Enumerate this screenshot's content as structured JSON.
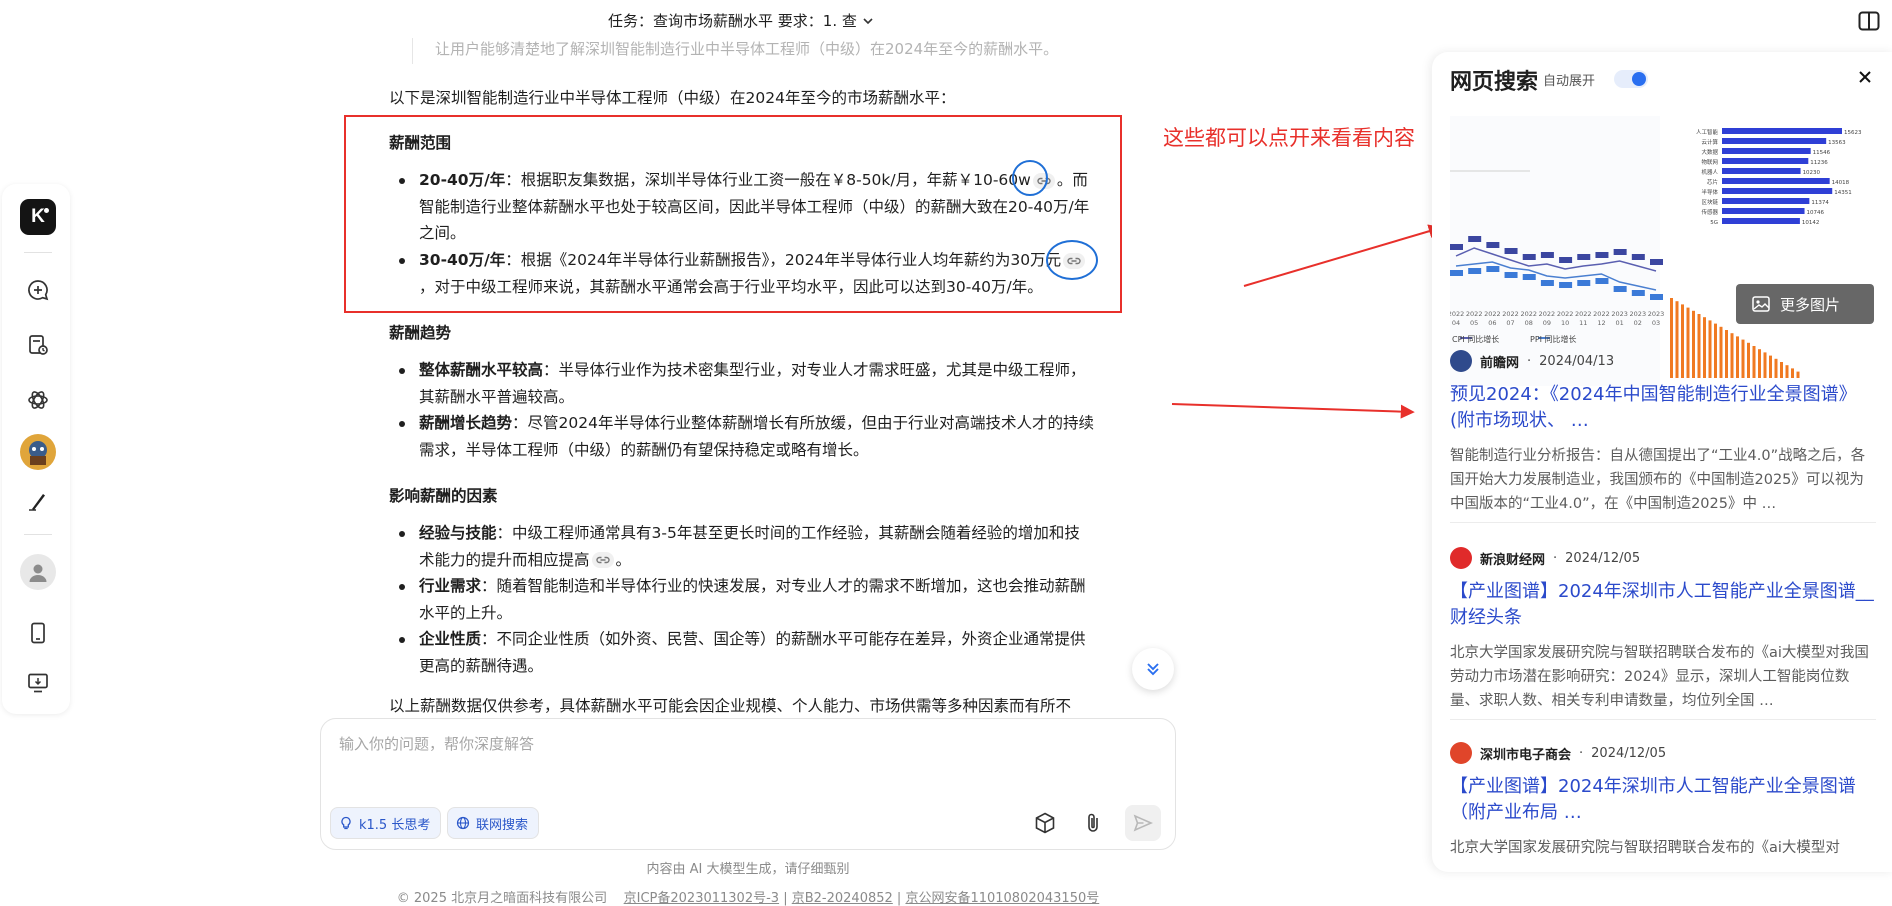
{
  "header": {
    "task_text": "任务：查询市场薪酬水平 要求：1. 查"
  },
  "chat": {
    "faded_line": "让用户能够清楚地了解深圳智能制造行业中半导体工程师（中级）在2024年至今的薪酬水平。",
    "intro": "以下是深圳智能制造行业中半导体工程师（中级）在2024年至今的市场薪酬水平：",
    "sections": [
      {
        "title": "薪酬范围",
        "items": [
          {
            "bold": "20-40万/年",
            "before_cite": "：根据职友集数据，深圳半导体行业工资一般在￥8-50k/月，年薪￥10-60w",
            "after_cite": "。而智能制造行业整体薪酬水平也处于较高区间，因此半导体工程师（中级）的薪酬大致在20-40万/年之间。"
          },
          {
            "bold": "30-40万/年",
            "before_cite": "：根据《2024年半导体行业薪酬报告》，2024年半导体行业人均年薪约为30万元",
            "after_cite": "，对于中级工程师来说，其薪酬水平通常会高于行业平均水平，因此可以达到30-40万/年。"
          }
        ]
      },
      {
        "title": "薪酬趋势",
        "items": [
          {
            "bold": "整体薪酬水平较高",
            "text": "：半导体行业作为技术密集型行业，对专业人才需求旺盛，尤其是中级工程师，其薪酬水平普遍较高。"
          },
          {
            "bold": "薪酬增长趋势",
            "text": "：尽管2024年半导体行业整体薪酬增长有所放缓，但由于行业对高端技术人才的持续需求，半导体工程师（中级）的薪酬仍有望保持稳定或略有增长。"
          }
        ]
      },
      {
        "title": "影响薪酬的因素",
        "items": [
          {
            "bold": "经验与技能",
            "before_cite": "：中级工程师通常具有3-5年甚至更长时间的工作经验，其薪酬会随着经验的增加和技术能力的提升而相应提高",
            "after_cite": "。"
          },
          {
            "bold": "行业需求",
            "text": "：随着智能制造和半导体行业的快速发展，对专业人才的需求不断增加，这也会推动薪酬水平的上升。"
          },
          {
            "bold": "企业性质",
            "text": "：不同企业性质（如外资、民营、国企等）的薪酬水平可能存在差异，外资企业通常提供更高的薪酬待遇。"
          }
        ]
      }
    ],
    "closing": "以上薪酬数据仅供参考，具体薪酬水平可能会因企业规模、个人能力、市场供需等多种因素而有所不"
  },
  "annotation": {
    "text": "这些都可以点开来看看内容",
    "color": "#e8302b"
  },
  "composer": {
    "placeholder": "输入你的问题，帮你深度解答",
    "chip_think": "k1.5 长思考",
    "chip_search": "联网搜索"
  },
  "footer": {
    "disclaimer": "内容由 AI 大模型生成，请仔细甄别",
    "copyright": "© 2025 北京月之暗面科技有限公司",
    "icp": "京ICP备2023011302号-3",
    "b2": "京B2-20240852",
    "police": "京公网安备11010802043150号"
  },
  "search_panel": {
    "title": "网页搜索",
    "auto_expand_label": "自动展开",
    "auto_expand_on": true,
    "more_images": "更多图片",
    "results": [
      {
        "source": "前瞻网",
        "date": "2024/04/13",
        "title": "预见2024：《2024年中国智能制造行业全景图谱》(附市场现状、 …",
        "snippet": "智能制造行业分析报告：自从德国提出了“工业4.0”战略之后，各国开始大力发展制造业，我国颁布的《中国制造2025》可以视为中国版本的“工业4.0”，在《中国制造2025》中 …",
        "icon_color": "#2f4a8c"
      },
      {
        "source": "新浪财经网",
        "date": "2024/12/05",
        "title": "【产业图谱】2024年深圳市人工智能产业全景图谱__财经头条",
        "snippet": "北京大学国家发展研究院与智联招聘联合发布的《ai大模型对我国劳动力市场潜在影响研究：2024》显示，深圳人工智能岗位数量、求职人数、相关专利申请数量，均位列全国 …",
        "icon_color": "#e02a2a"
      },
      {
        "source": "深圳市电子商会",
        "date": "2024/12/05",
        "title": "【产业图谱】2024年深圳市人工智能产业全景图谱（附产业布局 …",
        "snippet": "北京大学国家发展研究院与智联招聘联合发布的《ai大模型对",
        "icon_color": "#e0452a"
      }
    ]
  },
  "preview_chart": {
    "line_legend": [
      "CPI 同比增长",
      "PPI 同比增长"
    ],
    "x_ticks": [
      "2022/04",
      "2022/05",
      "2022/06",
      "2022/07",
      "2022/08",
      "2022/09",
      "2022/10",
      "2022/11",
      "2022/12",
      "2023/01",
      "2023/02",
      "2023/03"
    ],
    "bar_values": [
      15623,
      13563,
      11546,
      11236,
      10230,
      14018,
      14351,
      11374,
      10746,
      10142
    ],
    "bar_labels": [
      "人工智能",
      "云计算",
      "大数据",
      "物联网",
      "机器人",
      "芯片",
      "半导体",
      "区块链",
      "传感器",
      "5G"
    ]
  }
}
